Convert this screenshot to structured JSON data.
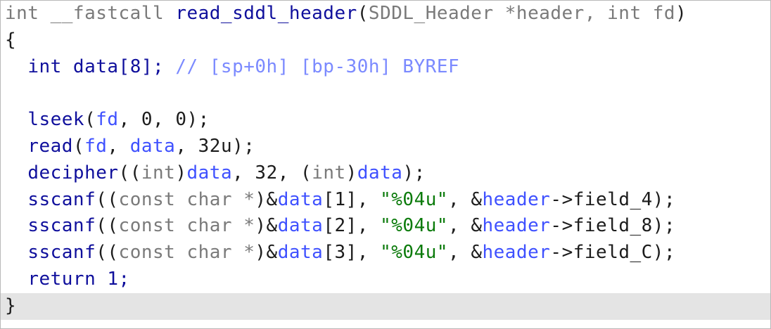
{
  "code_view": {
    "lines": [
      {
        "id": "signature",
        "indent": "",
        "tokens": [
          {
            "kind": "type",
            "text": "int __fastcall "
          },
          {
            "kind": "func",
            "text": "read_sddl_header"
          },
          {
            "kind": "punct",
            "text": "("
          },
          {
            "kind": "type",
            "text": "SDDL_Header *header, int fd"
          },
          {
            "kind": "punct",
            "text": ")"
          }
        ]
      },
      {
        "id": "open-brace",
        "indent": "",
        "tokens": [
          {
            "kind": "punct",
            "text": "{"
          }
        ]
      },
      {
        "id": "decl-data",
        "indent": "  ",
        "tokens": [
          {
            "kind": "fn",
            "text": "int data[8]; "
          },
          {
            "kind": "comment",
            "text": "// [sp+0h] [bp-30h] BYREF"
          }
        ]
      },
      {
        "id": "blank",
        "indent": "",
        "tokens": []
      },
      {
        "id": "lseek",
        "indent": "  ",
        "tokens": [
          {
            "kind": "fn",
            "text": "lseek"
          },
          {
            "kind": "punct",
            "text": "("
          },
          {
            "kind": "var",
            "text": "fd"
          },
          {
            "kind": "punct",
            "text": ", 0, 0);"
          }
        ]
      },
      {
        "id": "read",
        "indent": "  ",
        "tokens": [
          {
            "kind": "fn",
            "text": "read"
          },
          {
            "kind": "punct",
            "text": "("
          },
          {
            "kind": "var",
            "text": "fd"
          },
          {
            "kind": "punct",
            "text": ", "
          },
          {
            "kind": "var",
            "text": "data"
          },
          {
            "kind": "punct",
            "text": ", 32u);"
          }
        ]
      },
      {
        "id": "decipher",
        "indent": "  ",
        "tokens": [
          {
            "kind": "fn",
            "text": "decipher"
          },
          {
            "kind": "punct",
            "text": "(("
          },
          {
            "kind": "type",
            "text": "int"
          },
          {
            "kind": "punct",
            "text": ")"
          },
          {
            "kind": "var",
            "text": "data"
          },
          {
            "kind": "punct",
            "text": ", 32, ("
          },
          {
            "kind": "type",
            "text": "int"
          },
          {
            "kind": "punct",
            "text": ")"
          },
          {
            "kind": "var",
            "text": "data"
          },
          {
            "kind": "punct",
            "text": ");"
          }
        ]
      },
      {
        "id": "sscanf-1",
        "indent": "  ",
        "tokens": [
          {
            "kind": "fn",
            "text": "sscanf"
          },
          {
            "kind": "punct",
            "text": "(("
          },
          {
            "kind": "type",
            "text": "const char *"
          },
          {
            "kind": "punct",
            "text": ")&"
          },
          {
            "kind": "var",
            "text": "data"
          },
          {
            "kind": "punct",
            "text": "[1], "
          },
          {
            "kind": "str",
            "text": "\"%04u\""
          },
          {
            "kind": "punct",
            "text": ", &"
          },
          {
            "kind": "var",
            "text": "header"
          },
          {
            "kind": "punct",
            "text": "->field_4);"
          }
        ]
      },
      {
        "id": "sscanf-2",
        "indent": "  ",
        "tokens": [
          {
            "kind": "fn",
            "text": "sscanf"
          },
          {
            "kind": "punct",
            "text": "(("
          },
          {
            "kind": "type",
            "text": "const char *"
          },
          {
            "kind": "punct",
            "text": ")&"
          },
          {
            "kind": "var",
            "text": "data"
          },
          {
            "kind": "punct",
            "text": "[2], "
          },
          {
            "kind": "str",
            "text": "\"%04u\""
          },
          {
            "kind": "punct",
            "text": ", &"
          },
          {
            "kind": "var",
            "text": "header"
          },
          {
            "kind": "punct",
            "text": "->field_8);"
          }
        ]
      },
      {
        "id": "sscanf-3",
        "indent": "  ",
        "tokens": [
          {
            "kind": "fn",
            "text": "sscanf"
          },
          {
            "kind": "punct",
            "text": "(("
          },
          {
            "kind": "type",
            "text": "const char *"
          },
          {
            "kind": "punct",
            "text": ")&"
          },
          {
            "kind": "var",
            "text": "data"
          },
          {
            "kind": "punct",
            "text": "[3], "
          },
          {
            "kind": "str",
            "text": "\"%04u\""
          },
          {
            "kind": "punct",
            "text": ", &"
          },
          {
            "kind": "var",
            "text": "header"
          },
          {
            "kind": "punct",
            "text": "->field_C);"
          }
        ]
      },
      {
        "id": "return",
        "indent": "  ",
        "tokens": [
          {
            "kind": "fn",
            "text": "return 1;"
          }
        ]
      },
      {
        "id": "close-brace",
        "indent": "",
        "current": true,
        "tokens": [
          {
            "kind": "punct",
            "text": "}"
          }
        ]
      }
    ]
  },
  "colors": {
    "type": "#7a7a7a",
    "function": "#0f0f9c",
    "variable": "#3f51ff",
    "string": "#0a7a0a",
    "comment": "#7b8aff",
    "current_line": "#e4e4e4"
  }
}
